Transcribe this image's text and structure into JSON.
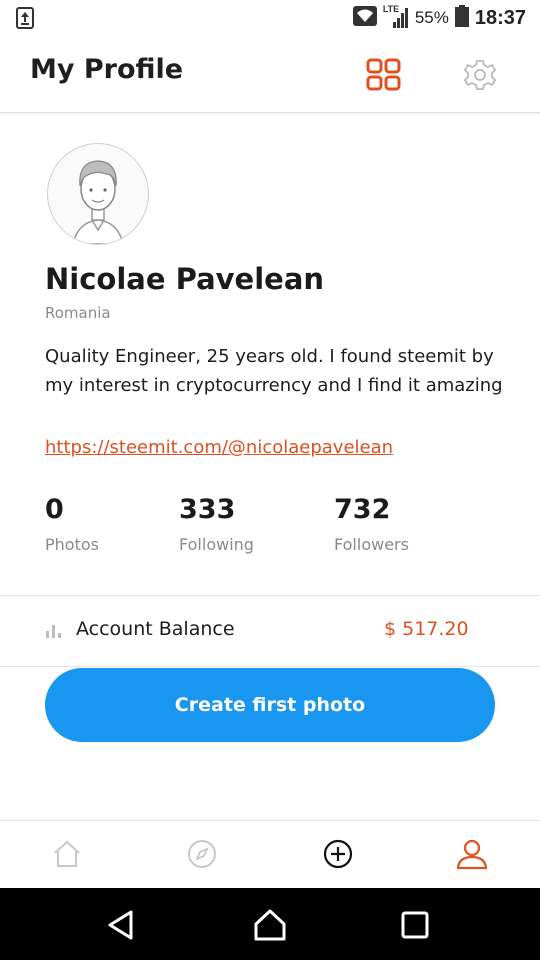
{
  "status_bar": {
    "network": "LTE",
    "battery": "55%",
    "time": "18:37"
  },
  "header": {
    "title": "My Profile",
    "grid_icon": "grid-icon",
    "settings_icon": "gear-icon",
    "accent": "#e0501f"
  },
  "profile": {
    "name": "Nicolae Pavelean",
    "location": "Romania",
    "bio": "Quality Engineer, 25 years old. I found steemit by my interest in cryptocurrency and I find it amazing",
    "link": "https://steemit.com/@nicolaepavelean"
  },
  "stats": [
    {
      "value": "0",
      "label": "Photos"
    },
    {
      "value": "333",
      "label": "Following"
    },
    {
      "value": "732",
      "label": "Followers"
    }
  ],
  "balance": {
    "label": "Account Balance",
    "value": "$ 517.20",
    "icon": "bar-chart-icon"
  },
  "cta": {
    "label": "Create first photo",
    "color": "#1996f0"
  },
  "tabs": [
    {
      "icon": "home-icon"
    },
    {
      "icon": "compass-icon"
    },
    {
      "icon": "plus-circle-icon"
    },
    {
      "icon": "user-icon",
      "active": true
    }
  ]
}
